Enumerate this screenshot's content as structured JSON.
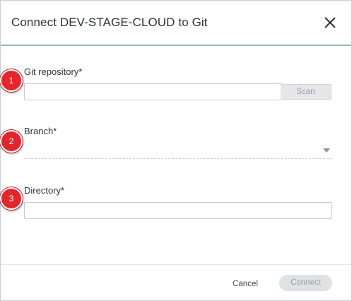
{
  "dialog": {
    "title": "Connect DEV-STAGE-CLOUD to Git",
    "close_icon": "close-icon"
  },
  "fields": {
    "repository": {
      "label": "Git repository*",
      "value": "",
      "scan_label": "Scan"
    },
    "branch": {
      "label": "Branch*",
      "value": ""
    },
    "directory": {
      "label": "Directory*",
      "value": ""
    }
  },
  "markers": [
    "1",
    "2",
    "3"
  ],
  "footer": {
    "cancel_label": "Cancel",
    "connect_label": "Connect"
  },
  "colors": {
    "marker": "#e3262c",
    "header_divider": "#9fb6c4",
    "disabled_button": "#dfe2e5"
  }
}
